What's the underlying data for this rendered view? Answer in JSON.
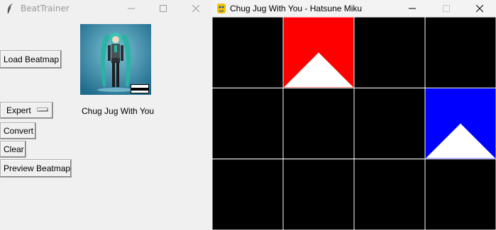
{
  "tk_window": {
    "title": "BeatTrainer",
    "load_button": "Load Beatmap",
    "difficulty": "Expert",
    "convert_button": "Convert",
    "clear_button": "Clear",
    "preview_button": "Preview Beatmap",
    "song_title": "Chug Jug With You",
    "album_art_label": "PARENTAL ADVISORY EXPLICIT CONTENT"
  },
  "pygame_window": {
    "title": "Chug Jug With You - Hatsune Miku",
    "grid": {
      "rows": 3,
      "cols": 4
    },
    "notes": [
      {
        "row": 0,
        "col": 1,
        "color": "#ff0000",
        "direction": "up"
      },
      {
        "row": 1,
        "col": 3,
        "color": "#0000ff",
        "direction": "up"
      }
    ]
  },
  "colors": {
    "note_red": "#ff0000",
    "note_blue": "#0000ff",
    "grid_line": "#ffffff",
    "cell_bg": "#000000"
  }
}
